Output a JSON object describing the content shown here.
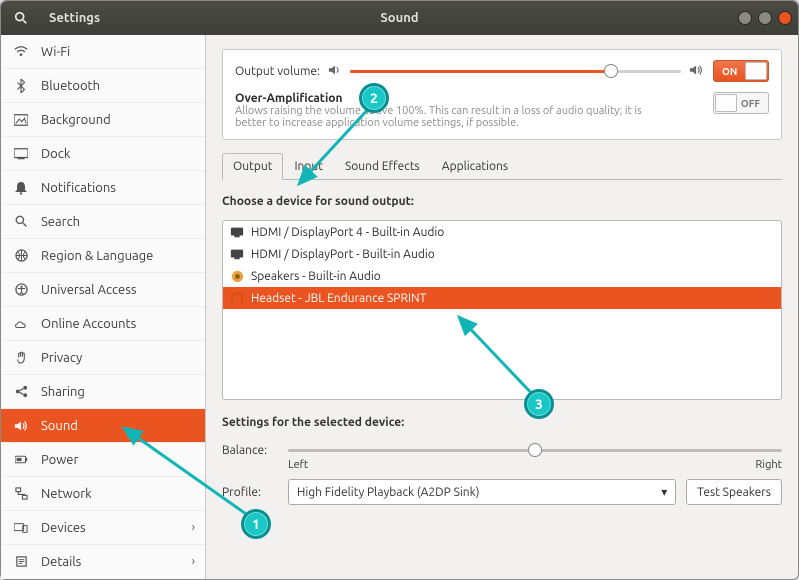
{
  "window": {
    "app_title": "Settings",
    "page_title": "Sound"
  },
  "sidebar": {
    "items": [
      {
        "label": "Wi-Fi"
      },
      {
        "label": "Bluetooth"
      },
      {
        "label": "Background"
      },
      {
        "label": "Dock"
      },
      {
        "label": "Notifications"
      },
      {
        "label": "Search"
      },
      {
        "label": "Region & Language"
      },
      {
        "label": "Universal Access"
      },
      {
        "label": "Online Accounts"
      },
      {
        "label": "Privacy"
      },
      {
        "label": "Sharing"
      },
      {
        "label": "Sound"
      },
      {
        "label": "Power"
      },
      {
        "label": "Network"
      },
      {
        "label": "Devices"
      },
      {
        "label": "Details"
      }
    ]
  },
  "output_volume": {
    "label": "Output volume:",
    "toggle_label": "ON",
    "value_pct": 79
  },
  "over_amp": {
    "title": "Over-Amplification",
    "desc": "Allows raising the volume above 100%. This can result in a loss of audio quality; it is better to increase application volume settings, if possible.",
    "toggle_label": "OFF"
  },
  "tabs": {
    "items": [
      "Output",
      "Input",
      "Sound Effects",
      "Applications"
    ]
  },
  "output": {
    "heading": "Choose a device for sound output:",
    "devices": [
      {
        "label": "HDMI / DisplayPort 4 - Built-in Audio"
      },
      {
        "label": "HDMI / DisplayPort - Built-in Audio"
      },
      {
        "label": "Speakers - Built-in Audio"
      },
      {
        "label": "Headset - JBL Endurance SPRINT"
      }
    ]
  },
  "selected_settings": {
    "heading": "Settings for the selected device:",
    "balance_label": "Balance:",
    "left_label": "Left",
    "right_label": "Right",
    "profile_label": "Profile:",
    "profile_value": "High Fidelity Playback (A2DP Sink)",
    "test_label": "Test Speakers"
  },
  "annotations": {
    "n1": "1",
    "n2": "2",
    "n3": "3"
  }
}
